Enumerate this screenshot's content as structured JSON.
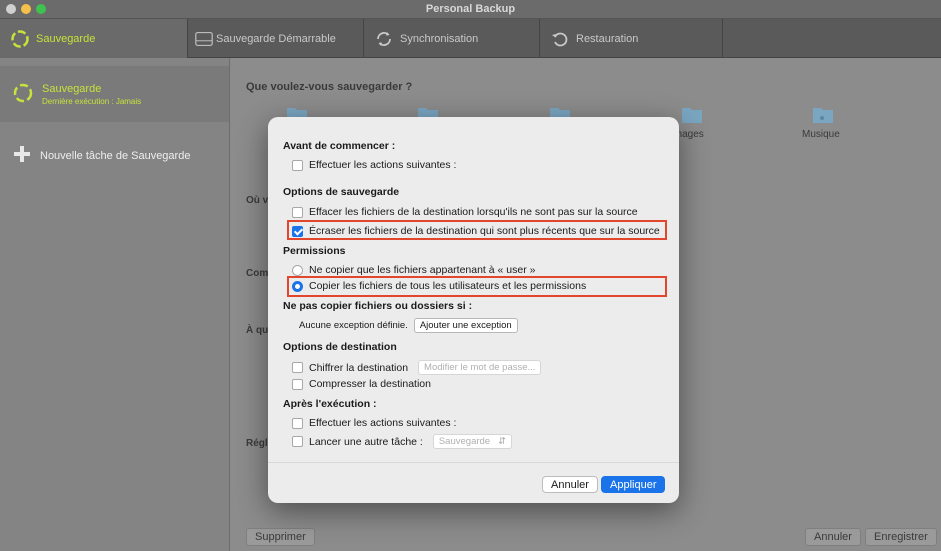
{
  "window": {
    "title": "Personal Backup"
  },
  "tabs": [
    {
      "label": "Sauvegarde",
      "icon": "backup-ring-icon",
      "active": true
    },
    {
      "label": "Sauvegarde Démarrable",
      "icon": "drive-icon",
      "active": false
    },
    {
      "label": "Synchronisation",
      "icon": "sync-icon",
      "active": false
    },
    {
      "label": "Restauration",
      "icon": "restore-icon",
      "active": false
    }
  ],
  "sidebar": {
    "task": {
      "title": "Sauvegarde",
      "subtitle": "Dernière exécution : Jamais"
    },
    "add_label": "Nouvelle tâche de Sauvegarde"
  },
  "main": {
    "heading": "Que voulez-vous sauvegarder ?",
    "folders": [
      "Images",
      "Musique"
    ],
    "fragments": [
      "Où v",
      "Com",
      "À qu",
      "Régl"
    ],
    "delete_button": "Supprimer",
    "cancel_button": "Annuler",
    "save_button": "Enregistrer"
  },
  "dialog": {
    "before": {
      "title": "Avant de commencer :",
      "option": {
        "label": "Effectuer les actions suivantes :",
        "checked": false
      }
    },
    "backup_options": {
      "title": "Options de sauvegarde",
      "items": [
        {
          "label": "Effacer les fichiers de la destination lorsqu'ils ne sont pas sur la source",
          "checked": false
        },
        {
          "label": "Écraser les fichiers de la destination qui sont plus récents que sur la source",
          "checked": true
        }
      ]
    },
    "permissions": {
      "title": "Permissions",
      "items": [
        {
          "label": "Ne copier que les fichiers appartenant à « user »",
          "selected": false
        },
        {
          "label": "Copier les fichiers de tous les utilisateurs et les permissions",
          "selected": true
        }
      ]
    },
    "exclusions": {
      "title": "Ne pas copier fichiers ou dossiers si :",
      "none_text": "Aucune exception définie.",
      "add_button": "Ajouter une exception"
    },
    "destination": {
      "title": "Options de destination",
      "encrypt": {
        "label": "Chiffrer la destination",
        "checked": false
      },
      "change_password_button": "Modifier le mot de passe...",
      "compress": {
        "label": "Compresser la destination",
        "checked": false
      }
    },
    "after": {
      "title": "Après l'exécution :",
      "actions": {
        "label": "Effectuer les actions suivantes :",
        "checked": false
      },
      "launch": {
        "label": "Lancer une autre tâche :",
        "checked": false
      },
      "task_select": "Sauvegarde"
    },
    "cancel_button": "Annuler",
    "apply_button": "Appliquer"
  },
  "colors": {
    "accent": "#1a73e8",
    "highlight": "#e2462d",
    "brand_green": "#c7e23a"
  }
}
